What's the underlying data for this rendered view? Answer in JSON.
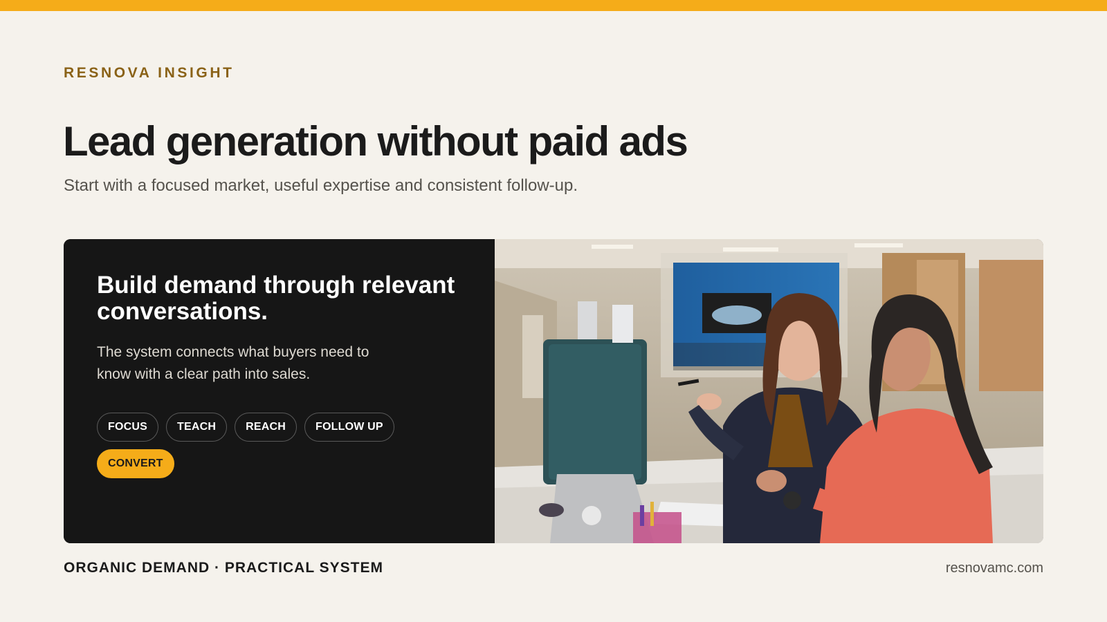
{
  "brand": {
    "eyebrow": "RESNOVA INSIGHT",
    "accent_color": "#f5ac19"
  },
  "hero": {
    "title": "Lead generation without paid ads",
    "subtitle": "Start with a focused market, useful expertise and consistent follow-up."
  },
  "card": {
    "title": "Build demand through relevant conversations.",
    "body": "The system connects what buyers need to know with a clear path into sales.",
    "tags": [
      {
        "label": "FOCUS",
        "active": false
      },
      {
        "label": "TEACH",
        "active": false
      },
      {
        "label": "REACH",
        "active": false
      },
      {
        "label": "FOLLOW UP",
        "active": false
      },
      {
        "label": "CONVERT",
        "active": true
      }
    ],
    "photo_icon": "office-meeting-photo"
  },
  "footer": {
    "tagline": "ORGANIC DEMAND · PRACTICAL SYSTEM",
    "domain": "resnovamc.com"
  }
}
